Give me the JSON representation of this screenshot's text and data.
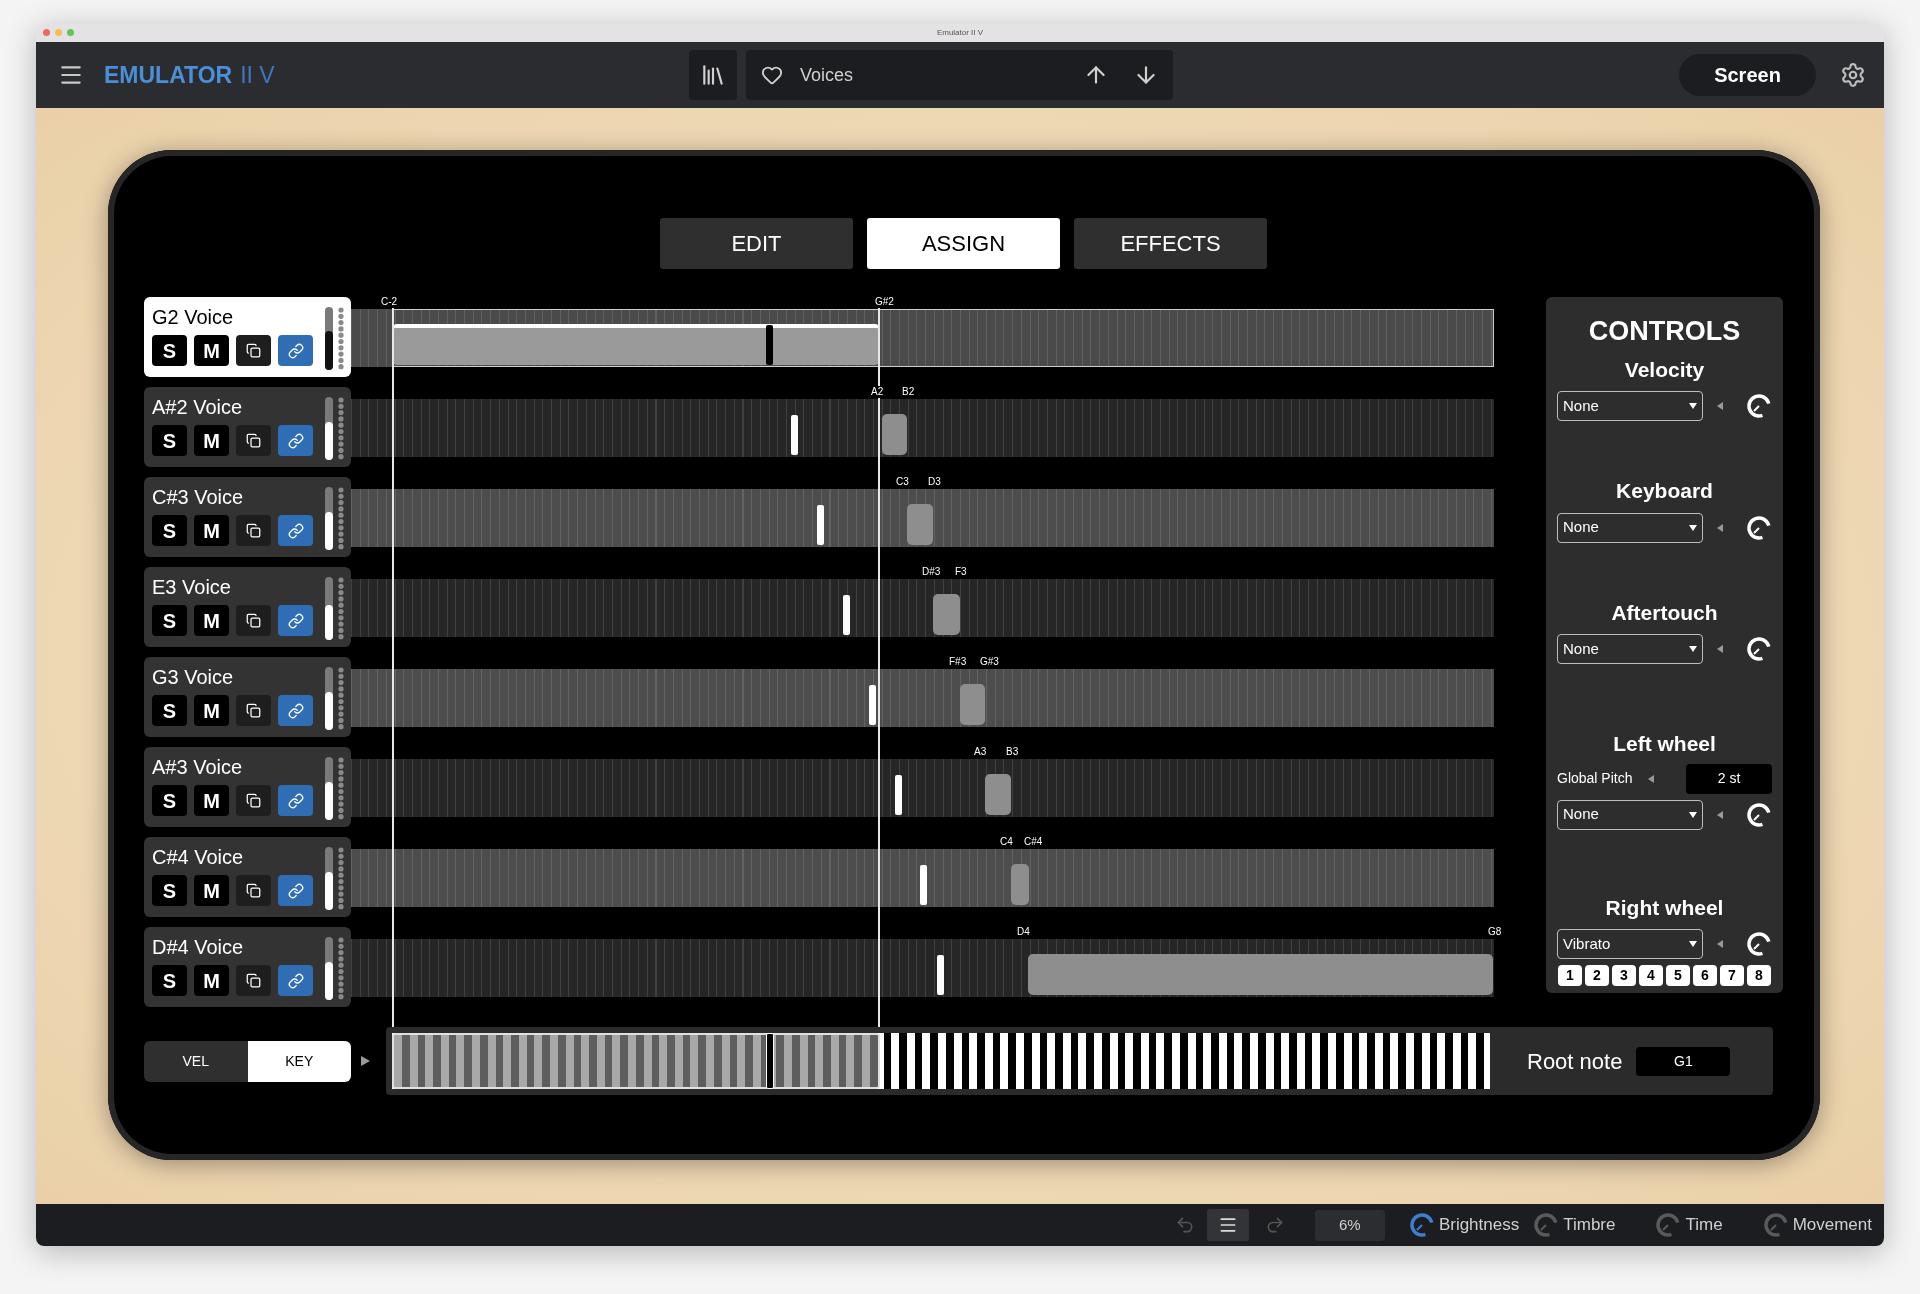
{
  "window": {
    "title": "Emulator II V"
  },
  "toolbar": {
    "logo": "EMULATOR",
    "logo_suffix": "II V",
    "preset": "Voices",
    "screen_button": "Screen"
  },
  "tabs": [
    {
      "label": "EDIT",
      "selected": false
    },
    {
      "label": "ASSIGN",
      "selected": true
    },
    {
      "label": "EFFECTS",
      "selected": false
    }
  ],
  "voices": [
    {
      "name": "G2 Voice",
      "selected": true,
      "solo": "S",
      "mute": "M",
      "linked": true,
      "level": 0.62,
      "low": "C-2",
      "high": "G#2"
    },
    {
      "name": "A#2 Voice",
      "selected": false,
      "solo": "S",
      "mute": "M",
      "linked": true,
      "level": 0.6,
      "low": "A2",
      "high": "B2"
    },
    {
      "name": "C#3 Voice",
      "selected": false,
      "solo": "S",
      "mute": "M",
      "linked": true,
      "level": 0.6,
      "low": "C3",
      "high": "D3"
    },
    {
      "name": "E3 Voice",
      "selected": false,
      "solo": "S",
      "mute": "M",
      "linked": true,
      "level": 0.56,
      "low": "D#3",
      "high": "F3"
    },
    {
      "name": "G3 Voice",
      "selected": false,
      "solo": "S",
      "mute": "M",
      "linked": true,
      "level": 0.6,
      "low": "F#3",
      "high": "G#3"
    },
    {
      "name": "A#3 Voice",
      "selected": false,
      "solo": "S",
      "mute": "M",
      "linked": true,
      "level": 0.6,
      "low": "A3",
      "high": "B3"
    },
    {
      "name": "C#4 Voice",
      "selected": false,
      "solo": "S",
      "mute": "M",
      "linked": true,
      "level": 0.6,
      "low": "C4",
      "high": "C#4"
    },
    {
      "name": "D#4 Voice",
      "selected": false,
      "solo": "S",
      "mute": "M",
      "linked": true,
      "level": 0.6,
      "low": "D4",
      "high": "G8"
    }
  ],
  "assign_mode": [
    {
      "label": "VEL",
      "selected": false
    },
    {
      "label": "KEY",
      "selected": true
    }
  ],
  "root_note": {
    "label": "Root note",
    "value": "G1"
  },
  "controls": {
    "title": "CONTROLS",
    "sections": [
      {
        "kind": "select",
        "label": "Velocity",
        "value": "None"
      },
      {
        "kind": "select",
        "label": "Keyboard",
        "value": "None"
      },
      {
        "kind": "select",
        "label": "Aftertouch",
        "value": "None"
      },
      {
        "kind": "pitch",
        "label": "Left wheel",
        "param": "Global Pitch",
        "param_value": "2 st",
        "value": "None"
      },
      {
        "kind": "slots",
        "label": "Right wheel",
        "value": "Vibrato",
        "slots": [
          "1",
          "2",
          "3",
          "4",
          "5",
          "6",
          "7",
          "8"
        ]
      }
    ]
  },
  "status_bar": {
    "zoom": "6%",
    "macros": [
      {
        "label": "Brightness",
        "active": true
      },
      {
        "label": "Timbre",
        "active": false
      },
      {
        "label": "Time",
        "active": false
      },
      {
        "label": "Movement",
        "active": false
      }
    ]
  }
}
